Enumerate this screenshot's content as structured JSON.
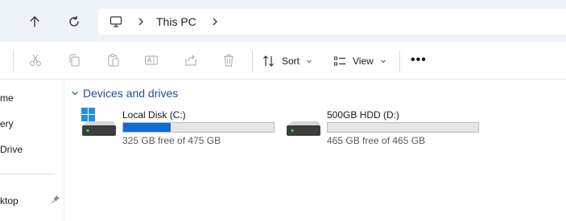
{
  "address_bar": {
    "breadcrumb": "This PC"
  },
  "toolbar": {
    "sort_label": "Sort",
    "view_label": "View",
    "more_label": "•••"
  },
  "sidebar": {
    "items": [
      {
        "label": "me"
      },
      {
        "label": "ery"
      },
      {
        "label": "Drive"
      },
      {
        "label": "ktop"
      }
    ]
  },
  "group": {
    "title": "Devices and drives"
  },
  "drives": [
    {
      "name": "Local Disk (C:)",
      "free_text": "325 GB free of 475 GB",
      "used_fraction": 0.316,
      "has_windows_logo": true
    },
    {
      "name": "500GB HDD (D:)",
      "free_text": "465 GB free of 465 GB",
      "used_fraction": 0.0,
      "has_windows_logo": false
    }
  ],
  "colors": {
    "accent": "#0f6cd4",
    "group_title": "#1f4e9c",
    "address_bg": "#eef2f9"
  },
  "icons": [
    "up-arrow-icon",
    "refresh-icon",
    "this-pc-icon",
    "chevron-right-icon",
    "cut-icon",
    "copy-icon",
    "paste-icon",
    "rename-icon",
    "share-icon",
    "delete-icon",
    "sort-icon",
    "view-icon",
    "chevron-down-icon",
    "pin-icon",
    "drive-icon",
    "windows-logo-icon"
  ]
}
